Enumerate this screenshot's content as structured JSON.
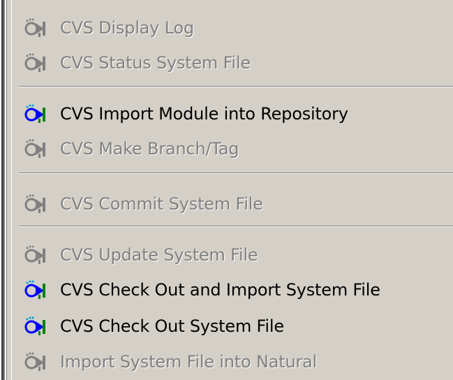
{
  "menu": {
    "items": [
      {
        "label": "CVS Display Log",
        "enabled": false,
        "icon": "cvs-icon"
      },
      {
        "label": "CVS Status System File",
        "enabled": false,
        "icon": "cvs-icon"
      },
      {
        "label": "CVS Import Module into Repository",
        "enabled": true,
        "icon": "cvs-icon"
      },
      {
        "label": "CVS Make Branch/Tag",
        "enabled": false,
        "icon": "cvs-icon"
      },
      {
        "label": "CVS Commit System File",
        "enabled": false,
        "icon": "cvs-icon"
      },
      {
        "label": "CVS Update System File",
        "enabled": false,
        "icon": "cvs-icon"
      },
      {
        "label": "CVS Check Out and Import System File",
        "enabled": true,
        "icon": "cvs-icon"
      },
      {
        "label": "CVS Check Out System File",
        "enabled": true,
        "icon": "cvs-icon"
      },
      {
        "label": "Import System File into Natural",
        "enabled": false,
        "icon": "cvs-icon"
      }
    ]
  },
  "colors": {
    "menu_bg": "#d4d0c8",
    "enabled_text": "#000000",
    "disabled_text": "#808080",
    "icon_blue": "#0000ff",
    "icon_green": "#008000",
    "icon_cyan": "#00a0d0"
  }
}
